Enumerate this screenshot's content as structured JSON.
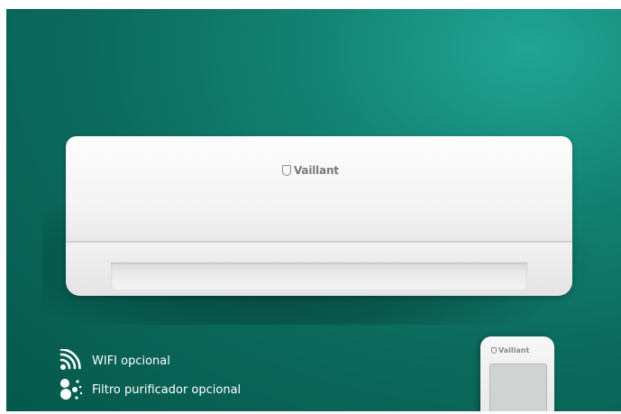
{
  "product": {
    "brand": "Vaillant",
    "remote_brand": "Vaillant"
  },
  "features": [
    {
      "icon": "wifi-icon",
      "label": "WIFI opcional"
    },
    {
      "icon": "purifier-filter-icon",
      "label": "Filtro purificador opcional"
    }
  ],
  "colors": {
    "background": "#0b6a5c",
    "background_highlight": "#21a594",
    "unit_body": "#f3f3f3",
    "text": "#ffffff"
  }
}
